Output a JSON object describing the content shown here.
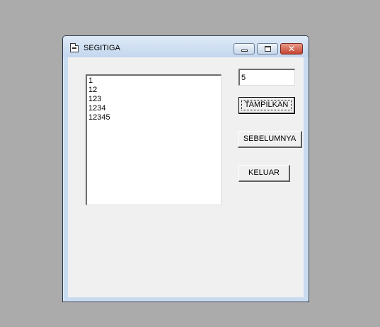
{
  "window": {
    "title": "SEGITIGA",
    "icon": "form-icon",
    "controls": {
      "minimize_icon": "minimize-icon",
      "maximize_icon": "maximize-icon",
      "close_icon": "close-icon",
      "close_glyph": "✕"
    }
  },
  "form": {
    "input_value": "5",
    "list_items": [
      "1",
      "12",
      "123",
      "1234",
      "12345"
    ],
    "buttons": {
      "tampilkan": "TAMPILKAN",
      "sebelumnya": "SEBELUMNYA",
      "keluar": "KELUAR"
    }
  },
  "colors": {
    "desktop": "#ababab",
    "form_background": "#f0f0f0",
    "close_button": "#c4432f"
  }
}
